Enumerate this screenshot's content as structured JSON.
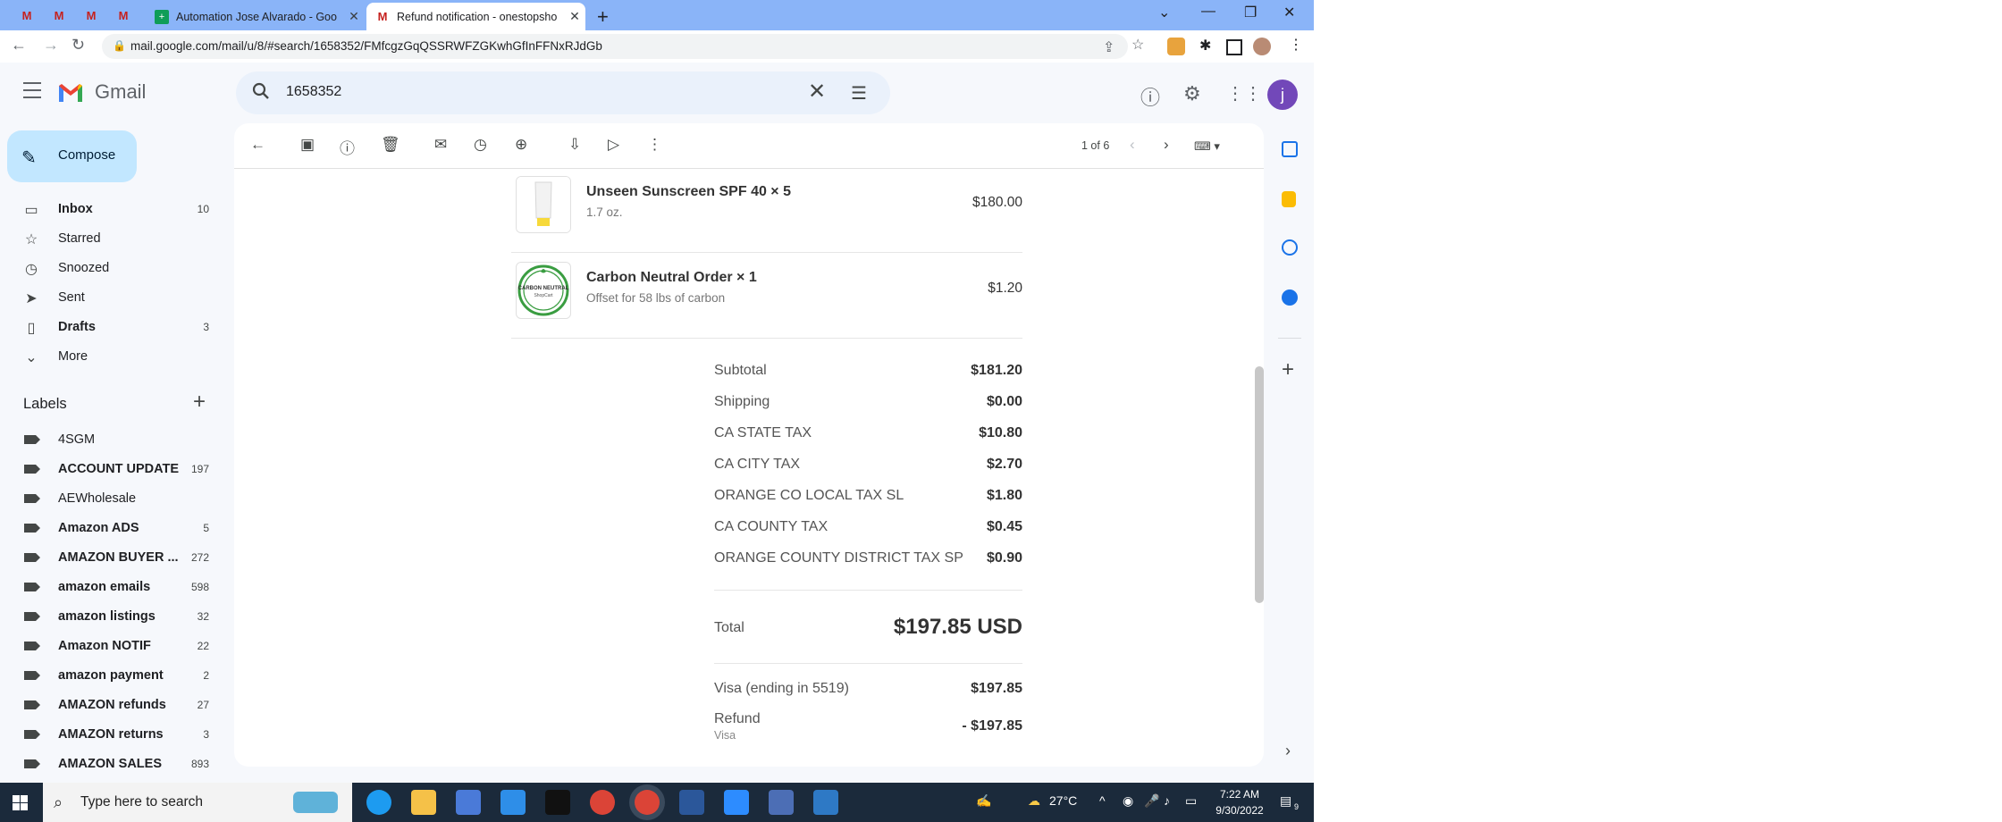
{
  "browser": {
    "tabs": [
      {
        "title": "Automation Jose Alvarado - Goo",
        "active": false
      },
      {
        "title": "Refund notification - onestopsho",
        "active": true
      }
    ],
    "url": "mail.google.com/mail/u/8/#search/1658352/FMfcgzGqQSSRWFZGKwhGfInFFNxRJdGb"
  },
  "gmail": {
    "app_name": "Gmail",
    "search_query": "1658352",
    "avatar_letter": "j",
    "compose_label": "Compose",
    "nav": [
      {
        "label": "Inbox",
        "count": "10",
        "bold": true
      },
      {
        "label": "Starred",
        "count": ""
      },
      {
        "label": "Snoozed",
        "count": ""
      },
      {
        "label": "Sent",
        "count": ""
      },
      {
        "label": "Drafts",
        "count": "3",
        "bold": true
      },
      {
        "label": "More",
        "count": ""
      }
    ],
    "labels_heading": "Labels",
    "labels": [
      {
        "name": "4SGM",
        "count": ""
      },
      {
        "name": "ACCOUNT UPDATE",
        "count": "197"
      },
      {
        "name": "AEWholesale",
        "count": ""
      },
      {
        "name": "Amazon ADS",
        "count": "5"
      },
      {
        "name": "AMAZON BUYER ...",
        "count": "272"
      },
      {
        "name": "amazon emails",
        "count": "598"
      },
      {
        "name": "amazon listings",
        "count": "32"
      },
      {
        "name": "Amazon NOTIF",
        "count": "22"
      },
      {
        "name": "amazon payment",
        "count": "2"
      },
      {
        "name": "AMAZON refunds",
        "count": "27"
      },
      {
        "name": "AMAZON returns",
        "count": "3"
      },
      {
        "name": "AMAZON SALES",
        "count": "893"
      }
    ],
    "pager": "1 of 6"
  },
  "email": {
    "items": [
      {
        "name": "Unseen Sunscreen SPF 40 × 5",
        "variant": "1.7 oz.",
        "price": "$180.00"
      },
      {
        "name": "Carbon Neutral Order × 1",
        "variant": "Offset for 58 lbs of carbon",
        "price": "$1.20"
      }
    ],
    "carbon_logo_text": "CARBON NEUTRAL",
    "carbon_logo_sub": "ShopCart",
    "summary": [
      {
        "label": "Subtotal",
        "value": "$181.20"
      },
      {
        "label": "Shipping",
        "value": "$0.00"
      },
      {
        "label": "CA STATE TAX",
        "value": "$10.80"
      },
      {
        "label": "CA CITY TAX",
        "value": "$2.70"
      },
      {
        "label": "ORANGE CO LOCAL TAX SL",
        "value": "$1.80"
      },
      {
        "label": "CA COUNTY TAX",
        "value": "$0.45"
      },
      {
        "label": "ORANGE COUNTY DISTRICT TAX SP",
        "value": "$0.90"
      }
    ],
    "total_label": "Total",
    "total_value": "$197.85 USD",
    "payment_label": "Visa (ending in 5519)",
    "payment_value": "$197.85",
    "refund_label": "Refund",
    "refund_method": "Visa",
    "refund_value": "- $197.85"
  },
  "taskbar": {
    "search_placeholder": "Type here to search",
    "weather": "27°C",
    "time": "7:22 AM",
    "date": "9/30/2022",
    "notification_count": "9"
  },
  "colors": {
    "tabstrip": "#8ab4f8",
    "compose": "#c2e7ff",
    "avatar": "#7248b9",
    "taskbar": "#1b2a3b"
  }
}
